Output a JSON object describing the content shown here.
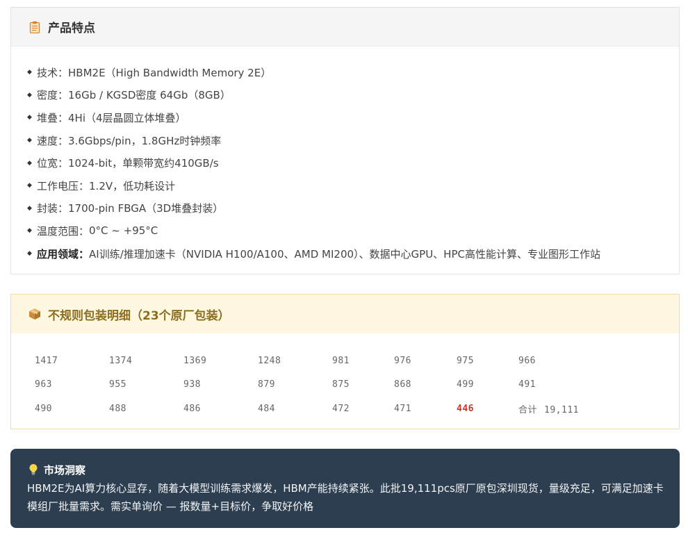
{
  "features": {
    "title": "产品特点",
    "items": [
      {
        "label": "技术：",
        "value": "HBM2E（High Bandwidth Memory 2E）",
        "bold": false
      },
      {
        "label": "密度：",
        "value": "16Gb / KGSD密度 64Gb（8GB）",
        "bold": false
      },
      {
        "label": "堆叠：",
        "value": "4Hi（4层晶圆立体堆叠）",
        "bold": false
      },
      {
        "label": "速度：",
        "value": "3.6Gbps/pin，1.8GHz时钟频率",
        "bold": false
      },
      {
        "label": "位宽：",
        "value": "1024-bit，单颗带宽约410GB/s",
        "bold": false
      },
      {
        "label": "工作电压：",
        "value": "1.2V，低功耗设计",
        "bold": false
      },
      {
        "label": "封装：",
        "value": "1700-pin FBGA（3D堆叠封装）",
        "bold": false
      },
      {
        "label": "温度范围：",
        "value": "0°C ~ +95°C",
        "bold": false
      },
      {
        "label": "应用领域：",
        "value": "AI训练/推理加速卡（NVIDIA H100/A100、AMD MI200）、数据中心GPU、HPC高性能计算、专业图形工作站",
        "bold": true
      }
    ]
  },
  "packing": {
    "title": "不规则包装明细（23个原厂包装）",
    "rows": [
      [
        "1417",
        "1374",
        "1369",
        "1248",
        "981",
        "976",
        "975",
        "966"
      ],
      [
        "963",
        "955",
        "938",
        "879",
        "875",
        "868",
        "499",
        "491"
      ],
      [
        "490",
        "488",
        "486",
        "484",
        "472",
        "471",
        "446"
      ]
    ],
    "total_label": "合计",
    "total_value": "19,111"
  },
  "insight": {
    "title": "市场洞察",
    "text": "HBM2E为AI算力核心显存，随着大模型训练需求爆发，HBM产能持续紧张。此批19,111pcs原厂原包深圳现货，量级充足，可满足加速卡模组厂批量需求。需实单询价 — 报数量+目标价，争取好价格"
  },
  "colors": {
    "highlight": "#c0392b",
    "insight_bg": "#2c3e50",
    "packing_header_bg": "#fff8e1",
    "packing_title": "#8a6d1f"
  },
  "icons": {
    "features": "clipboard-icon",
    "packing": "package-icon",
    "insight": "lightbulb-icon",
    "bullet": "diamond-bullet-icon"
  }
}
